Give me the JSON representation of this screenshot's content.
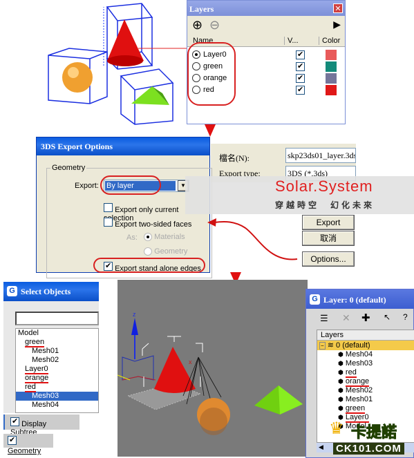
{
  "layers_panel": {
    "title": "Layers",
    "add_icon": "plus-circle-icon",
    "remove_icon": "minus-circle-icon",
    "details_icon": "details-arrow-icon",
    "columns": [
      "Name",
      "V...",
      "Color"
    ],
    "rows": [
      {
        "name": "Layer0",
        "active": true,
        "visible": true,
        "color": "#e85a5a"
      },
      {
        "name": "green",
        "active": false,
        "visible": true,
        "color": "#138a7a"
      },
      {
        "name": "orange",
        "active": false,
        "visible": true,
        "color": "#75759a"
      },
      {
        "name": "red",
        "active": false,
        "visible": true,
        "color": "#e01818"
      }
    ]
  },
  "export_dialog": {
    "title": "3DS Export Options",
    "group": "Geometry",
    "export_label": "Export:",
    "export_value": "By layer",
    "only_selection": "Export only current selection",
    "two_sided": "Export two-sided faces",
    "as_label": "As:",
    "materials": "Materials",
    "geometry": "Geometry",
    "stand_alone": "Export stand alone edges"
  },
  "file_dialog": {
    "filename_label": "檔名(N):",
    "filename_value": "skp23ds01_layer.3ds",
    "type_label": "Export type:",
    "type_value": "3DS (*.3ds)",
    "export_btn": "Export",
    "cancel_btn": "取消",
    "options_btn": "Options..."
  },
  "watermark": {
    "title": "Solar.System",
    "subtitle": "穿越時空　幻化未來"
  },
  "select_objects": {
    "title": "Select Objects",
    "search_value": "",
    "items": [
      {
        "label": "Model",
        "indent": 0,
        "marked": false,
        "selected": false
      },
      {
        "label": "green",
        "indent": 1,
        "marked": true,
        "selected": false
      },
      {
        "label": "Mesh01",
        "indent": 2,
        "marked": false,
        "selected": false
      },
      {
        "label": "Mesh02",
        "indent": 2,
        "marked": false,
        "selected": false
      },
      {
        "label": "Layer0",
        "indent": 1,
        "marked": true,
        "selected": false
      },
      {
        "label": "orange",
        "indent": 1,
        "marked": true,
        "selected": false
      },
      {
        "label": "red",
        "indent": 1,
        "marked": true,
        "selected": false
      },
      {
        "label": "Mesh03",
        "indent": 2,
        "marked": false,
        "selected": true
      },
      {
        "label": "Mesh04",
        "indent": 2,
        "marked": false,
        "selected": false
      }
    ],
    "display_subtree": "Display Subtree",
    "geometry": "Geometry"
  },
  "viewport": {
    "axis_z": "z",
    "axis_x": "x"
  },
  "layer_dialog": {
    "title": "Layer: 0 (default)",
    "column": "Layers",
    "root": "0 (default)",
    "items": [
      {
        "label": "Mesh04",
        "marked": false
      },
      {
        "label": "Mesh03",
        "marked": false
      },
      {
        "label": "red",
        "marked": true
      },
      {
        "label": "orange",
        "marked": true
      },
      {
        "label": "Mesh02",
        "marked": false
      },
      {
        "label": "Mesh01",
        "marked": false
      },
      {
        "label": "green",
        "marked": true
      },
      {
        "label": "Layer0",
        "marked": true
      },
      {
        "label": "Model",
        "marked": false
      }
    ]
  },
  "logo": {
    "text": "卡提諾",
    "site": "CK101.COM"
  }
}
